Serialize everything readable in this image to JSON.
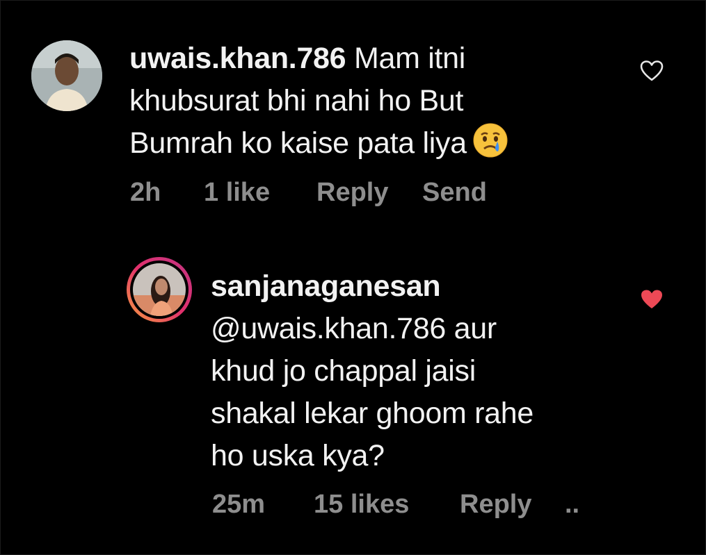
{
  "comments": [
    {
      "username": "uwais.khan.786",
      "text_first": "Mam itni",
      "lines": [
        "khubsurat bhi nahi ho But",
        "Bumrah ko kaise pata liya"
      ],
      "emoji": "crying-face",
      "time": "2h",
      "likes": "1 like",
      "reply": "Reply",
      "send": "Send",
      "liked": false
    },
    {
      "username": "sanjanaganesan",
      "lines": [
        "@uwais.khan.786 aur",
        "khud jo chappal jaisi",
        "shakal lekar ghoom rahe",
        "ho uska kya?"
      ],
      "time": "25m",
      "likes": "15 likes",
      "reply": "Reply",
      "more": "..",
      "liked": true,
      "heart_color": "#ed4956"
    }
  ],
  "colors": {
    "background": "#000000",
    "text": "#f2f2f2",
    "meta": "#8e8e8e",
    "story_ring": "#e1306c"
  }
}
